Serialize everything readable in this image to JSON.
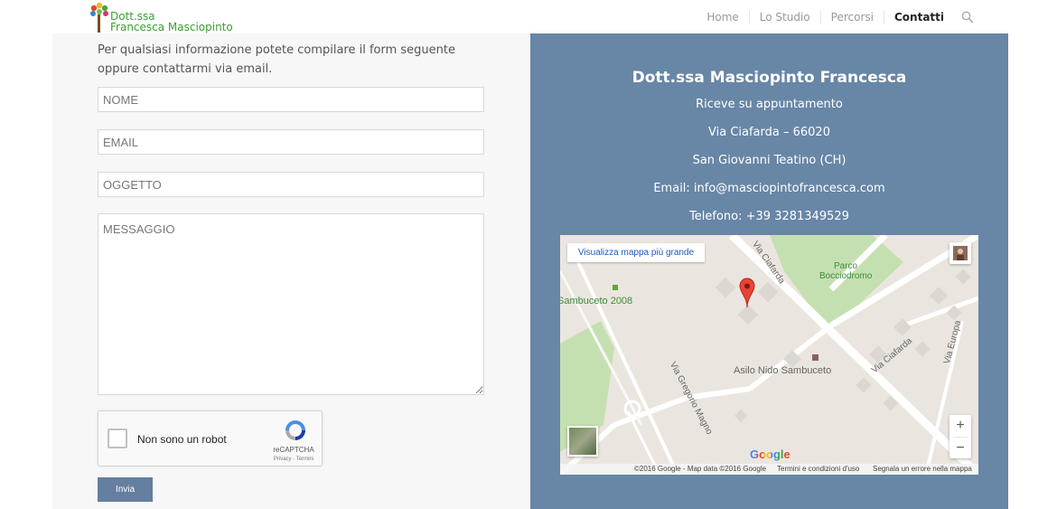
{
  "header": {
    "logo_line1": "Dott.ssa",
    "logo_line2": "Francesca Masciopinto",
    "nav": [
      "Home",
      "Lo Studio",
      "Percorsi",
      "Contatti"
    ],
    "active_nav": "Contatti"
  },
  "form": {
    "intro": "Per qualsiasi informazione potete compilare il form seguente oppure contattarmi via email.",
    "name_placeholder": "NOME",
    "email_placeholder": "EMAIL",
    "subject_placeholder": "OGGETTO",
    "message_placeholder": "MESSAGGIO",
    "captcha_label": "Non sono un robot",
    "captcha_brand": "reCAPTCHA",
    "captcha_links": "Privacy - Termini",
    "submit_label": "Invia"
  },
  "contact": {
    "title": "Dott.ssa Masciopinto Francesca",
    "line1": "Riceve su appuntamento",
    "address": "Via Ciafarda – 66020",
    "city": "San Giovanni Teatino (CH)",
    "email": "Email: info@masciopintofrancesca.com",
    "phone": "Telefono: +39 3281349529"
  },
  "map": {
    "view_larger": "Visualizza mappa più grande",
    "labels": {
      "parco": "Parco",
      "bocciodromo": "Bocciodromo",
      "sambuceto": "Sambuceto 2008",
      "via_ciafarda_1": "Via Ciafarda",
      "via_ciafarda_2": "Via Ciafarda",
      "via_europa": "Via Europa",
      "via_gregorio": "Via Gregorio Magno",
      "asilo": "Asilo Nido Sambuceto"
    },
    "google": "Google",
    "footer_data": "©2016 Google - Map data ©2016 Google",
    "footer_terms": "Termini e condizioni d'uso",
    "footer_report": "Segnala un errore nella mappa"
  },
  "colors": {
    "panel": "#6886a6",
    "button": "#647f9f",
    "logo_green": "#3aa02e"
  }
}
